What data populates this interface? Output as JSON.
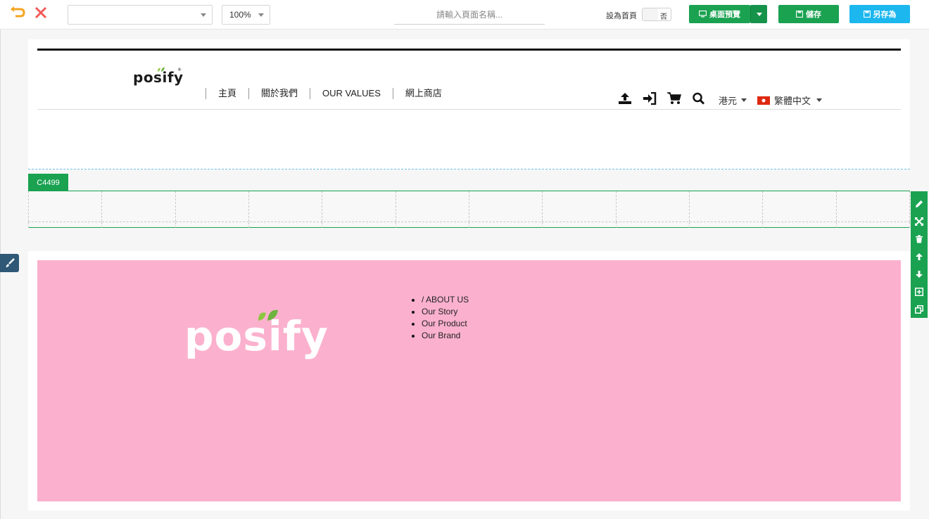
{
  "toolbar": {
    "page_select_value": "",
    "zoom_value": "100%",
    "page_name_placeholder": "請輸入頁面名稱...",
    "set_home_label": "設為首頁",
    "set_home_toggle_text": "否",
    "preview_label": "桌面預覽",
    "save_label": "儲存",
    "save_as_label": "另存為",
    "colors": {
      "green": "#1aa251",
      "blue": "#1bb7ee",
      "undo": "#f5a623",
      "close": "#f25a5a"
    }
  },
  "site_header": {
    "logo": "posify",
    "nav_items": [
      "主頁",
      "關於我們",
      "OUR VALUES",
      "網上商店"
    ],
    "icons": [
      "upload-icon",
      "sign-in-icon",
      "cart-icon",
      "search-icon"
    ],
    "currency": "港元",
    "language": "繁體中文"
  },
  "row": {
    "tag": "C4499",
    "column_count": 12
  },
  "side_tools": [
    "pencil-icon",
    "expand-icon",
    "trash-icon",
    "arrow-up-icon",
    "arrow-down-icon",
    "plus-square-icon",
    "copy-icon"
  ],
  "footer": {
    "logo": "posify",
    "background": "#fbb1cd",
    "links": [
      "/ ABOUT US",
      "Our Story",
      "Our Product",
      "Our Brand"
    ]
  }
}
